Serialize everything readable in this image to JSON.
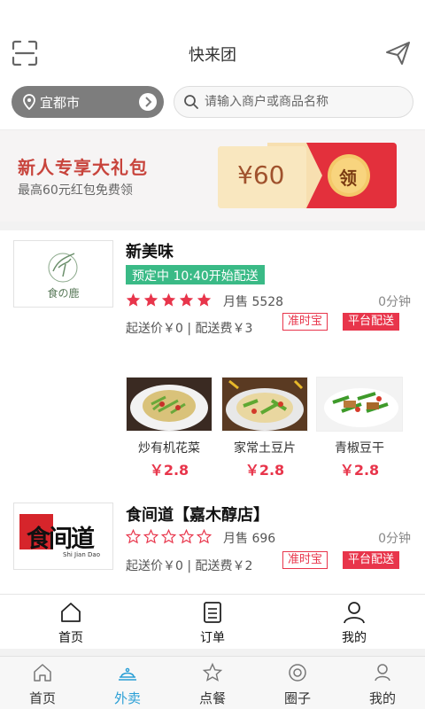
{
  "header": {
    "title": "快来团"
  },
  "location": {
    "city": "宜都市"
  },
  "search": {
    "placeholder": "请输入商户或商品名称"
  },
  "banner": {
    "title": "新人专享大礼包",
    "subtitle": "最高60元红包免费领",
    "amount": "¥60",
    "claim_label": "领"
  },
  "shops": [
    {
      "name": "新美味",
      "logo_text": "食の鹿",
      "preorder": "预定中 10:40开始配送",
      "rating": 5,
      "sales": "月售 5528",
      "time": "0分钟",
      "fee": "起送价￥0 | 配送费￥3",
      "tag1": "准时宝",
      "tag2": "平台配送",
      "dishes": [
        {
          "name": "炒有机花菜",
          "price": "￥2.8"
        },
        {
          "name": "家常土豆片",
          "price": "￥2.8"
        },
        {
          "name": "青椒豆干",
          "price": "￥2.8"
        }
      ]
    },
    {
      "name": "食间道【嘉木醇店】",
      "logo_text": "食间道",
      "logo_sub": "Shi Jian Dao",
      "rating": 0,
      "sales": "月售 696",
      "time": "0分钟",
      "fee": "起送价￥0 | 配送费￥2",
      "tag1": "准时宝",
      "tag2": "平台配送"
    }
  ],
  "subnav": [
    {
      "label": "首页",
      "icon": "home-icon"
    },
    {
      "label": "订单",
      "icon": "order-icon"
    },
    {
      "label": "我的",
      "icon": "user-icon"
    }
  ],
  "tabbar": [
    {
      "label": "首页",
      "icon": "home-icon"
    },
    {
      "label": "外卖",
      "icon": "cloche-icon",
      "active": true
    },
    {
      "label": "点餐",
      "icon": "star-icon"
    },
    {
      "label": "圈子",
      "icon": "circle-icon"
    },
    {
      "label": "我的",
      "icon": "user-icon"
    }
  ],
  "colors": {
    "accent_red": "#e8354b",
    "preorder_green": "#3aba86",
    "active_blue": "#2a9fd6"
  }
}
